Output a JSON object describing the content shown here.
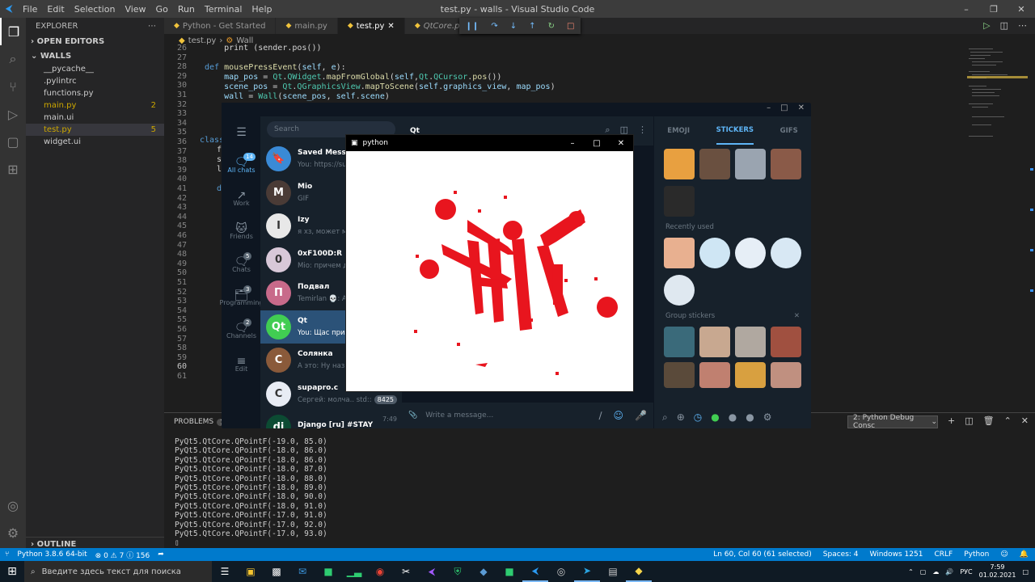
{
  "titlebar": {
    "menu": [
      "File",
      "Edit",
      "Selection",
      "View",
      "Go",
      "Run",
      "Terminal",
      "Help"
    ],
    "title": "test.py - walls - Visual Studio Code"
  },
  "sidebar": {
    "header": "EXPLORER",
    "open_editors": "OPEN EDITORS",
    "folder": "WALLS",
    "items": [
      {
        "label": "__pycache__",
        "badge": ""
      },
      {
        "label": ".pylintrc",
        "badge": ""
      },
      {
        "label": "functions.py",
        "badge": ""
      },
      {
        "label": "main.py",
        "badge": "2"
      },
      {
        "label": "main.ui",
        "badge": ""
      },
      {
        "label": "test.py",
        "badge": "5"
      },
      {
        "label": "widget.ui",
        "badge": ""
      }
    ],
    "outline": "OUTLINE"
  },
  "tabs": [
    "Python - Get Started",
    "main.py",
    "test.py",
    "QtCore.pyi"
  ],
  "breadcrumb": {
    "file": "test.py",
    "symbol": "Wall"
  },
  "editor": {
    "line_numbers": [
      "26",
      "27",
      "28",
      "29",
      "30",
      "31",
      "32",
      "33",
      "34",
      "35",
      "36",
      "37",
      "38",
      "39",
      "40",
      "41",
      "42",
      "43",
      "44",
      "45",
      "46",
      "47",
      "48",
      "49",
      "50",
      "51",
      "52",
      "53",
      "54",
      "55",
      "56",
      "57",
      "58",
      "59",
      "60",
      "61"
    ],
    "code": [
      "    print (sender.pos())",
      "",
      "def mousePressEvent(self, e):",
      "    map_pos = Qt.QWidget.mapFromGlobal(self,Qt.QCursor.pos())",
      "    scene_pos = Qt.QGraphicsView.mapToScene(self.graphics_view, map_pos)",
      "    wall = Wall(scene_pos, self.scene)"
    ],
    "left_fragments": [
      "class",
      "f",
      "s",
      "l",
      "d"
    ]
  },
  "panel": {
    "problems_label": "PROBLEMS",
    "problems_count": "163",
    "terminal_select": "2: Python Debug Consc",
    "lines": [
      "PyQt5.QtCore.QPointF(-19.0, 85.0)",
      "PyQt5.QtCore.QPointF(-18.0, 86.0)",
      "PyQt5.QtCore.QPointF(-18.0, 86.0)",
      "PyQt5.QtCore.QPointF(-18.0, 87.0)",
      "PyQt5.QtCore.QPointF(-18.0, 88.0)",
      "PyQt5.QtCore.QPointF(-18.0, 89.0)",
      "PyQt5.QtCore.QPointF(-18.0, 90.0)",
      "PyQt5.QtCore.QPointF(-18.0, 91.0)",
      "PyQt5.QtCore.QPointF(-17.0, 91.0)",
      "PyQt5.QtCore.QPointF(-17.0, 92.0)",
      "PyQt5.QtCore.QPointF(-17.0, 93.0)"
    ]
  },
  "status": {
    "python": "Python 3.8.6 64-bit",
    "errors": "0",
    "warnings": "7",
    "info": "156",
    "position": "Ln 60, Col 60 (61 selected)",
    "spaces": "Spaces: 4",
    "encoding": "Windows 1251",
    "eol": "CRLF",
    "lang": "Python"
  },
  "taskbar": {
    "search_placeholder": "Введите здесь текст для поиска",
    "lang": "РУС",
    "time": "7:59",
    "date": "01.02.2021"
  },
  "telegram": {
    "search": "Search",
    "rail": [
      {
        "label": "All chats",
        "count": "14"
      },
      {
        "label": "Work",
        "count": ""
      },
      {
        "label": "Friends",
        "count": ""
      },
      {
        "label": "Chats",
        "count": "5"
      },
      {
        "label": "Programming",
        "count": "3"
      },
      {
        "label": "Channels",
        "count": "2"
      },
      {
        "label": "Edit",
        "count": ""
      }
    ],
    "chats": [
      {
        "name": "Saved Messag",
        "msg": "You: https://su",
        "time": "",
        "badge": "",
        "color": "#3a8ad6",
        "initial": "🔖"
      },
      {
        "name": "Mio",
        "msg": "GIF",
        "time": "",
        "badge": "",
        "color": "#4a3b36",
        "initial": "M"
      },
      {
        "name": "Izy",
        "msg": "я хз, может мо",
        "time": "",
        "badge": "",
        "color": "#e8e8e8",
        "initial": "I"
      },
      {
        "name": "0xF100D:R",
        "msg": "Mio: причем д",
        "time": "",
        "badge": "",
        "color": "#d8c8d8",
        "initial": "0"
      },
      {
        "name": "Подвал",
        "msg": "Temirlan 💀: Al",
        "time": "",
        "badge": "",
        "color": "#c86a8a",
        "initial": "П"
      },
      {
        "name": "Qt",
        "msg": "You: Щас прил",
        "time": "",
        "badge": "",
        "color": "#41cd52",
        "initial": "Qt"
      },
      {
        "name": "Солянка",
        "msg": "А это: Ну назы",
        "time": "",
        "badge": "",
        "color": "#8a5a3a",
        "initial": "С"
      },
      {
        "name": "supapro.c",
        "msg": "Сергей: молча.. std::",
        "time": "",
        "badge": "8425",
        "color": "#e8ecf4",
        "initial": "C"
      },
      {
        "name": "Django [ru] #STAY",
        "msg": "",
        "time": "7:49",
        "badge": "",
        "color": "#0c4b33",
        "initial": "dj"
      }
    ],
    "chat_title": "Qt",
    "compose_placeholder": "Write a message...",
    "sticker_tabs": [
      "EMOJI",
      "STICKERS",
      "GIFS"
    ],
    "recently_used": "Recently used",
    "group_stickers": "Group stickers"
  },
  "pywindow": {
    "title": "python"
  }
}
